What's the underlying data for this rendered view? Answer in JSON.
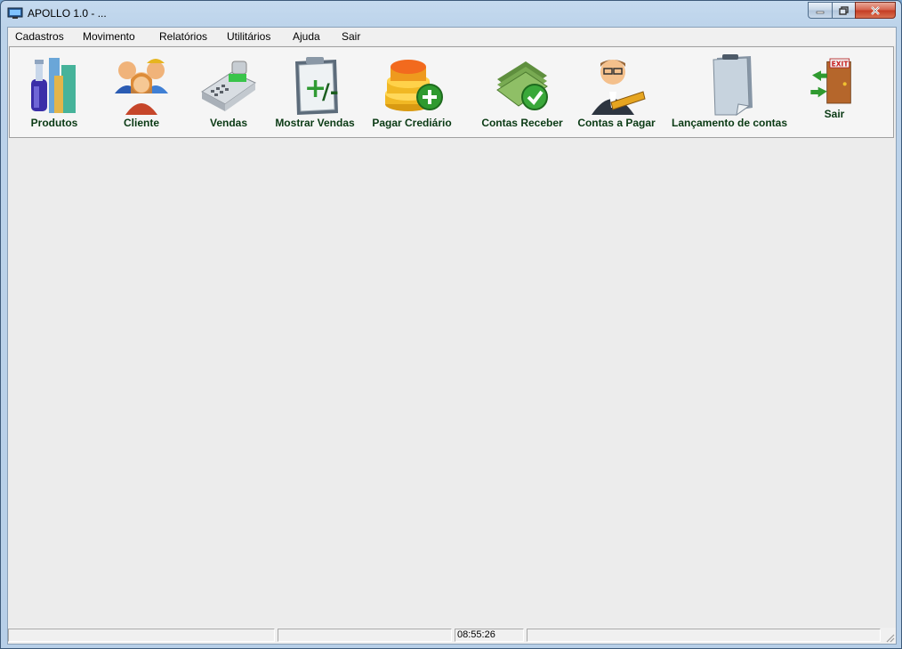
{
  "window": {
    "title": "APOLLO 1.0 - ..."
  },
  "caption": {
    "minimize": "minimize",
    "maximize": "maximize",
    "close": "close"
  },
  "menu": [
    {
      "label": "Cadastros"
    },
    {
      "label": "Movimento"
    },
    {
      "label": "Relatórios"
    },
    {
      "label": "Utilitários"
    },
    {
      "label": "Ajuda"
    },
    {
      "label": "Sair"
    }
  ],
  "toolbar": [
    {
      "label": "Produtos",
      "icon": "bottles-chart-icon"
    },
    {
      "label": "Cliente",
      "icon": "people-group-icon"
    },
    {
      "label": "Vendas",
      "icon": "cash-register-icon"
    },
    {
      "label": "Mostrar Vendas",
      "icon": "plus-minus-clipboard-icon"
    },
    {
      "label": "Pagar Crediário",
      "icon": "coins-add-icon"
    },
    {
      "label": "Contas Receber",
      "icon": "money-check-icon"
    },
    {
      "label": "Contas a Pagar",
      "icon": "person-book-icon"
    },
    {
      "label": "Lançamento de contas",
      "icon": "document-icon"
    },
    {
      "label": "Sair",
      "icon": "exit-door-icon"
    }
  ],
  "status": {
    "panel1": "",
    "panel2": "",
    "time": "08:55:26",
    "panel4": ""
  },
  "colors": {
    "toolbar_label": "#0a3a14",
    "client_bg": "#ececec"
  }
}
